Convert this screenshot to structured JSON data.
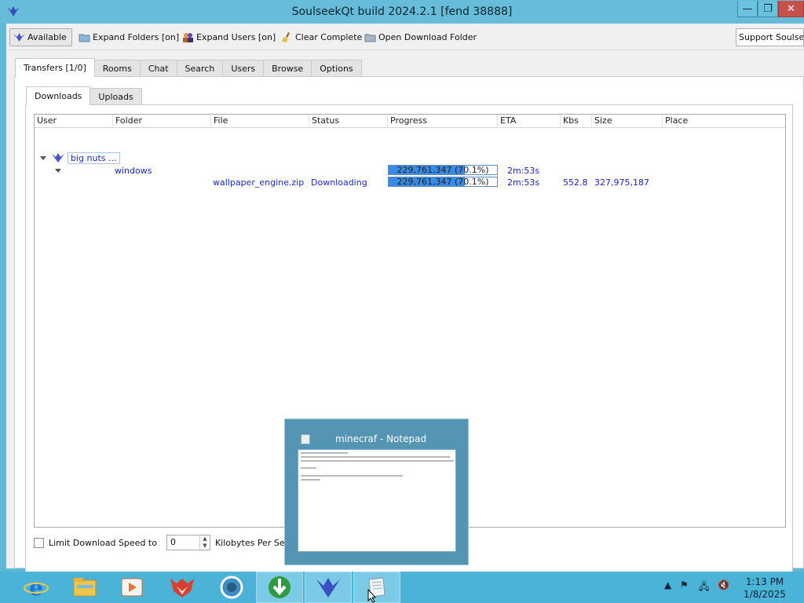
{
  "window": {
    "title": "SoulseekQt build 2024.2.1 [fend 38888]"
  },
  "toolbar": {
    "available": "Available",
    "expand_folders": "Expand Folders [on]",
    "expand_users": "Expand Users [on]",
    "clear_complete": "Clear Complete",
    "open_download_folder": "Open Download Folder",
    "support": "Support Soulseek"
  },
  "main_tabs": [
    {
      "label": "Transfers [1/0]",
      "active": true
    },
    {
      "label": "Rooms",
      "active": false
    },
    {
      "label": "Chat",
      "active": false
    },
    {
      "label": "Search",
      "active": false
    },
    {
      "label": "Users",
      "active": false
    },
    {
      "label": "Browse",
      "active": false
    },
    {
      "label": "Options",
      "active": false
    }
  ],
  "sub_tabs": [
    {
      "label": "Downloads",
      "active": true
    },
    {
      "label": "Uploads",
      "active": false
    }
  ],
  "table": {
    "columns": [
      "User",
      "Folder",
      "File",
      "Status",
      "Progress",
      "ETA",
      "Kbs",
      "Size",
      "Place"
    ],
    "user": "big nuts ...",
    "folder_row": {
      "folder": "windows",
      "progress_text": "229,761,347 (70.1%)",
      "progress": 0.701,
      "eta": "2m:53s"
    },
    "file_row": {
      "file": "wallpaper_engine.zip",
      "status": "Downloading",
      "progress_text": "229,761,347 (70.1%)",
      "progress": 0.701,
      "eta": "2m:53s",
      "kbs": "552.8",
      "size": "327,975,187"
    }
  },
  "limit": {
    "label": "Limit Download Speed to",
    "value": "0",
    "unit": "Kilobytes Per Second"
  },
  "thumbnail": {
    "title": "minecraf - Notepad"
  },
  "taskbar": {
    "time": "1:13 PM",
    "date": "1/8/2025"
  }
}
